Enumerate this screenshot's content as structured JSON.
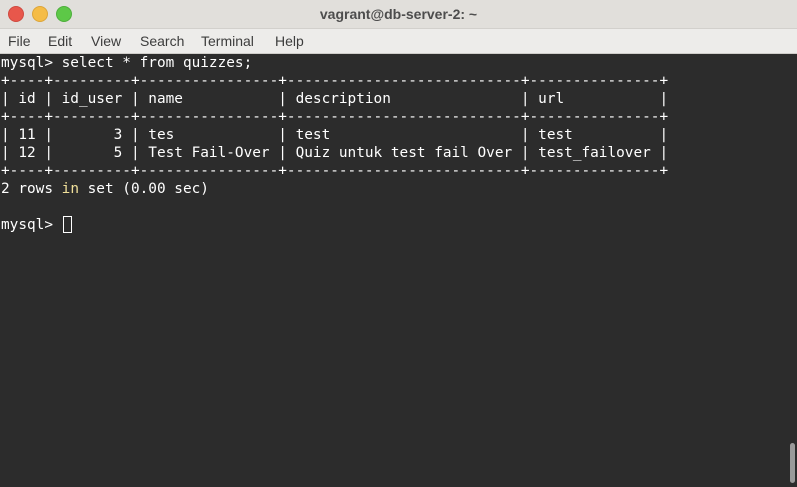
{
  "window": {
    "title": "vagrant@db-server-2: ~"
  },
  "menu": {
    "items": [
      "File",
      "Edit",
      "View",
      "Search",
      "Terminal",
      "Help"
    ]
  },
  "terminal": {
    "command_line": "mysql> select * from quizzes;",
    "border": "+----+---------+----------------+---------------------------+---------------+",
    "header_row": "| id | id_user | name           | description               | url           |",
    "rows": [
      "| 11 |       3 | tes            | test                      | test          |",
      "| 12 |       5 | Test Fail-Over | Quiz untuk test fail Over | test_failover |"
    ],
    "result_prefix": "2 rows ",
    "result_keyword": "in",
    "result_suffix": " set (0.00 sec)",
    "prompt": "mysql> "
  },
  "colors": {
    "terminal_bg": "#2c2c2c",
    "terminal_fg": "#ffffff",
    "keyword": "#f0e09a"
  }
}
